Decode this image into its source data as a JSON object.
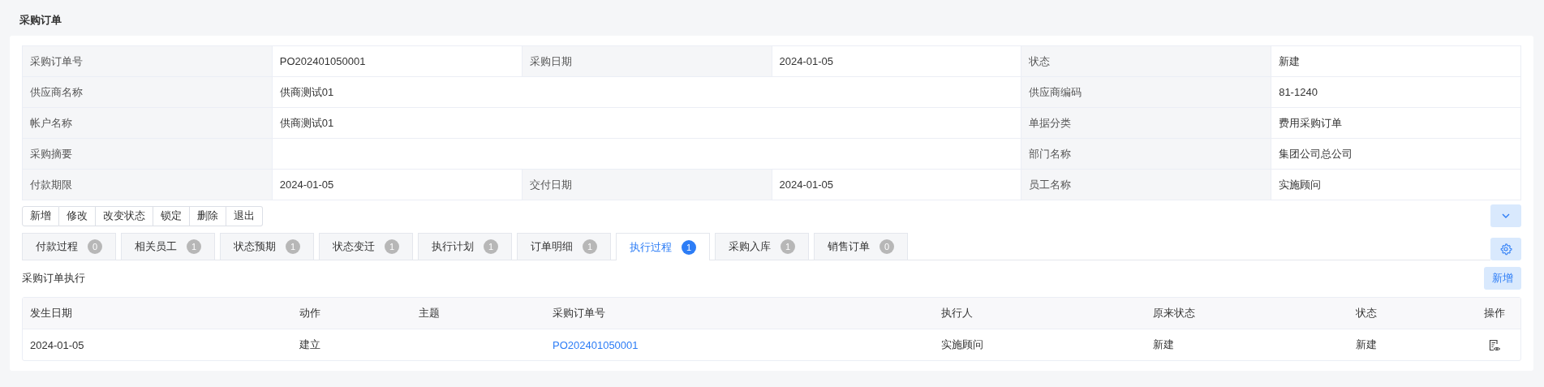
{
  "page_title": "采购订单",
  "info_rows": [
    {
      "fields": [
        {
          "label": "采购订单号",
          "value": "PO202401050001",
          "wide": false
        },
        {
          "label": "采购日期",
          "value": "2024-01-05",
          "wide": false
        },
        {
          "label": "状态",
          "value": "新建",
          "wide": false
        }
      ]
    },
    {
      "fields": [
        {
          "label": "供应商名称",
          "value": "供商测试01",
          "wide": true
        },
        {
          "label": "供应商编码",
          "value": "81-1240",
          "wide": false
        }
      ]
    },
    {
      "fields": [
        {
          "label": "帐户名称",
          "value": "供商测试01",
          "wide": true
        },
        {
          "label": "单据分类",
          "value": "费用采购订单",
          "wide": false
        }
      ]
    },
    {
      "fields": [
        {
          "label": "采购摘要",
          "wide": true
        },
        {
          "label": "部门名称",
          "value": "集团公司总公司",
          "wide": false
        }
      ]
    },
    {
      "fields": [
        {
          "label": "付款期限",
          "value": "2024-01-05",
          "wide": false
        },
        {
          "label": "交付日期",
          "value": "2024-01-05",
          "wide": false
        },
        {
          "label": "员工名称",
          "value": "实施顾问",
          "wide": false
        }
      ]
    }
  ],
  "actions": [
    "新增",
    "修改",
    "改变状态",
    "锁定",
    "删除",
    "退出"
  ],
  "tabs": [
    {
      "label": "付款过程",
      "count": "0",
      "selected": false
    },
    {
      "label": "相关员工",
      "count": "1",
      "selected": false
    },
    {
      "label": "状态预期",
      "count": "1",
      "selected": false
    },
    {
      "label": "状态变迁",
      "count": "1",
      "selected": false
    },
    {
      "label": "执行计划",
      "count": "1",
      "selected": false
    },
    {
      "label": "订单明细",
      "count": "1",
      "selected": false
    },
    {
      "label": "执行过程",
      "count": "1",
      "selected": true
    },
    {
      "label": "采购入库",
      "count": "1",
      "selected": false
    },
    {
      "label": "销售订单",
      "count": "0",
      "selected": false
    }
  ],
  "section": {
    "title": "采购订单执行",
    "add_button": "新增"
  },
  "table": {
    "columns": [
      "发生日期",
      "动作",
      "主题",
      "采购订单号",
      "执行人",
      "原来状态",
      "状态",
      "操作"
    ],
    "rows": [
      {
        "date": "2024-01-05",
        "action": "建立",
        "order_no": "PO202401050001",
        "executor": "实施顾问",
        "old_status": "新建",
        "status": "新建"
      }
    ]
  }
}
